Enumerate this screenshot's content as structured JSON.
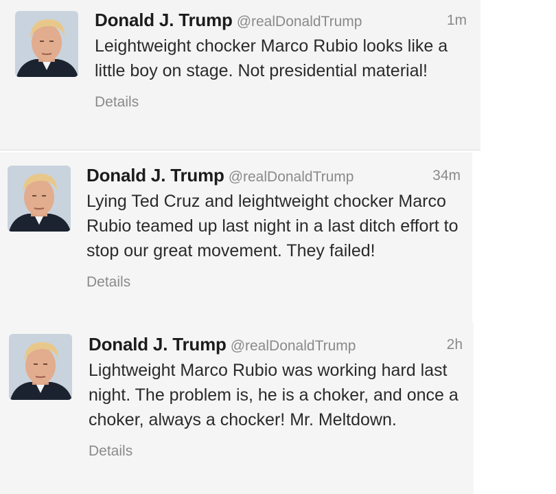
{
  "tweets": [
    {
      "display_name": "Donald J. Trump",
      "handle": "@realDonaldTrump",
      "time": "1m",
      "text": "Leightweight chocker Marco Rubio looks like a little boy on stage. Not presidential material!",
      "details_label": "Details"
    },
    {
      "display_name": "Donald J. Trump",
      "handle": "@realDonaldTrump",
      "time": "34m",
      "text": "Lying Ted Cruz and  leightweight chocker Marco Rubio teamed up last night in a last ditch effort to stop our great movement. They failed!",
      "details_label": "Details"
    },
    {
      "display_name": "Donald J. Trump",
      "handle": "@realDonaldTrump",
      "time": "2h",
      "text": "Lightweight Marco Rubio was working hard last night. The problem is, he is a choker, and once a choker, always a chocker! Mr. Meltdown.",
      "details_label": "Details"
    }
  ],
  "colors": {
    "tweet_background": "#f5f5f5",
    "name_text": "#1c1c1c",
    "secondary_text": "#8a8a8a",
    "body_text": "#2a2a2a"
  },
  "icons": {
    "avatar": "profile-photo"
  }
}
